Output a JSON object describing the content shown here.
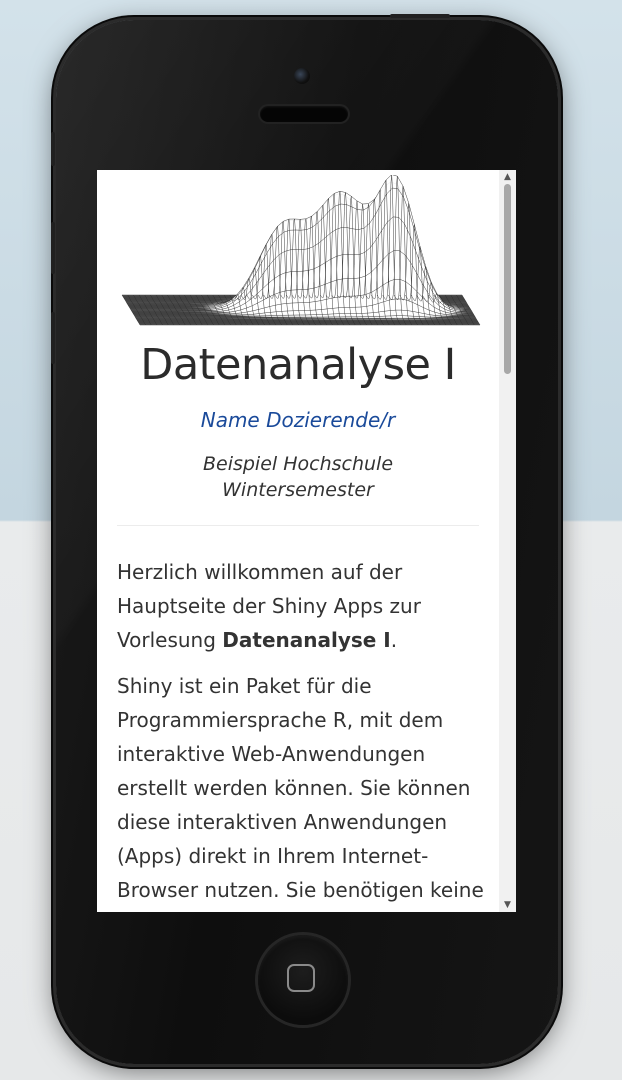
{
  "page": {
    "title": "Datenanalyse I",
    "author": "Name Dozierende/r",
    "institution": "Beispiel Hochschule",
    "semester": "Wintersemester"
  },
  "intro": {
    "p1_start": "Herzlich willkommen auf der Hauptseite der Shiny Apps zur Vorlesung ",
    "p1_bold": "Datenanalyse I",
    "p1_end": ".",
    "p2": "Shiny ist ein Paket für die Programmiersprache R, mit dem interaktive Web-Anwendungen erstellt werden können. Sie können diese interaktiven Anwendungen (Apps) direkt in Ihrem Internet-Browser nutzen. Sie benötigen keine"
  },
  "icons": {
    "hero": "wireframe-surface-plot-icon",
    "scroll_up": "triangle-up-icon",
    "scroll_down": "triangle-down-icon",
    "home": "home-square-icon"
  },
  "colors": {
    "link": "#1a4a9a",
    "text": "#333333",
    "phone_body": "#111111"
  }
}
